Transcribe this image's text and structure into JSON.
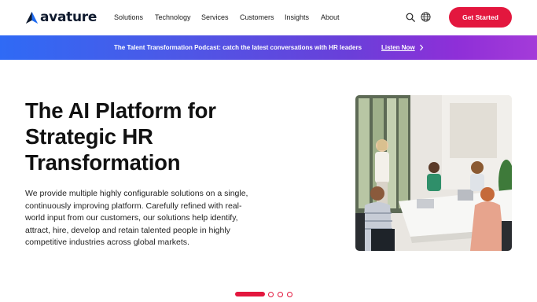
{
  "header": {
    "logo_text": "avature",
    "nav": [
      "Solutions",
      "Technology",
      "Services",
      "Customers",
      "Insights",
      "About"
    ],
    "cta_label": "Get Started",
    "icons": {
      "search": "search-icon",
      "language": "globe-icon"
    }
  },
  "banner": {
    "text": "The Talent Transformation Podcast: catch the latest conversations with HR leaders",
    "link_label": "Listen Now"
  },
  "hero": {
    "title_lines": [
      "The AI Platform for",
      "Strategic HR",
      "Transformation"
    ],
    "body_lines": [
      "We provide multiple highly configurable solutions on a single,",
      "continuously improving platform. Carefully refined with real-",
      "world input from our customers, our solutions help identify,",
      "attract, hire, develop and retain talented people in highly",
      "competitive industries across global markets."
    ]
  },
  "carousel": {
    "slides": 4,
    "active_index": 0
  },
  "colors": {
    "accent": "#e3173e",
    "brand_dark": "#0f1a2e",
    "logo_blue": "#1f6bf0",
    "banner_start": "#2f6af5",
    "banner_end": "#a43bd9"
  }
}
